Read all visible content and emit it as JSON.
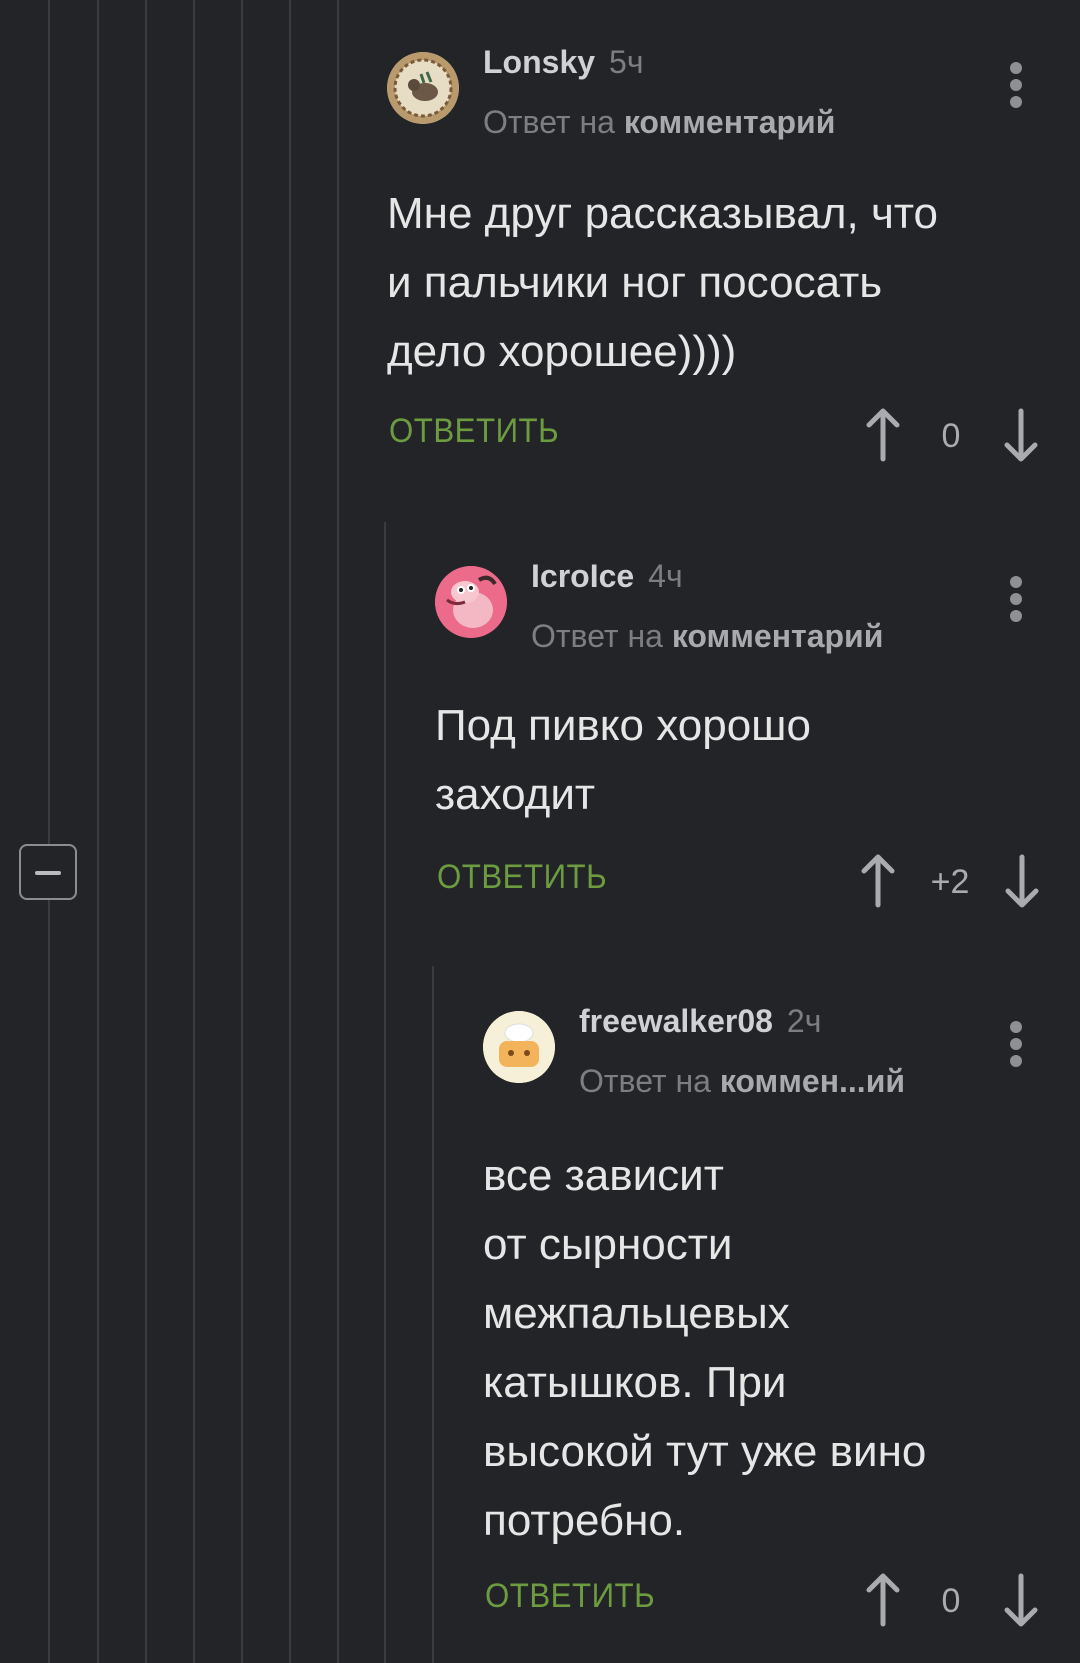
{
  "comments": [
    {
      "username": "Lonsky",
      "time": "5ч",
      "reply_prefix": "Ответ на",
      "reply_target": "комментарий",
      "body_lines": [
        "Мне друг рассказывал, что",
        "и пальчики ног пососать",
        "дело хорошее))))"
      ],
      "reply_label": "ОТВЕТИТЬ",
      "score": "0"
    },
    {
      "username": "IcroIce",
      "time": "4ч",
      "reply_prefix": "Ответ на",
      "reply_target": "комментарий",
      "body_lines": [
        "Под пивко хорошо",
        "заходит"
      ],
      "reply_label": "ОТВЕТИТЬ",
      "score": "+2"
    },
    {
      "username": "freewalker08",
      "time": "2ч",
      "reply_prefix": "Ответ на",
      "reply_target": "коммен...ий",
      "body_lines": [
        "все зависит",
        "от сырности",
        "межпальцевых",
        "катышков. При",
        "высокой тут уже вино",
        "потребно."
      ],
      "reply_label": "ОТВЕТИТЬ",
      "score": "0"
    }
  ],
  "icons": {
    "upvote": "arrow-up-icon",
    "downvote": "arrow-down-icon",
    "more": "more-vertical-icon",
    "collapse": "minus-icon"
  },
  "colors": {
    "background": "#222427",
    "thread_line": "#3a3c40",
    "reply_action": "#6c9c3f",
    "username": "#cfd1d3",
    "muted": "#7c7e81"
  }
}
